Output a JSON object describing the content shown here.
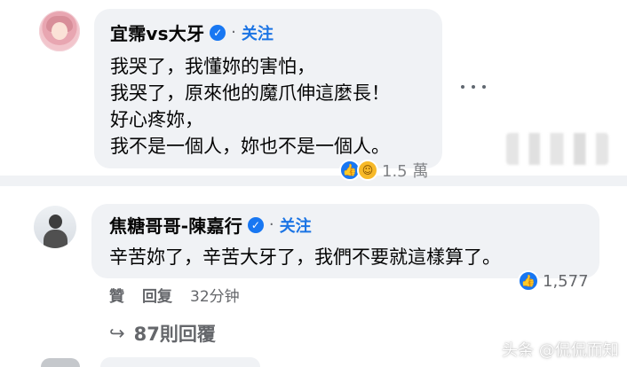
{
  "comments": [
    {
      "author": "宜霈vs大牙",
      "follow": "关注",
      "lines": [
        "我哭了，我懂妳的害怕，",
        "我哭了，原來他的魔爪伸這麼長！",
        "好心疼妳，",
        "我不是一個人，妳也不是一個人。"
      ],
      "reaction_count": "1.5 萬"
    },
    {
      "author": "焦糖哥哥-陳嘉行",
      "follow": "关注",
      "lines": [
        "辛苦妳了，辛苦大牙了，我們不要就這樣算了。"
      ],
      "actions": {
        "like": "贊",
        "reply": "回复",
        "time": "32分钟"
      },
      "reaction_count": "1,577",
      "replies": "87則回覆"
    }
  ],
  "watermark": "头条 @侃侃而知",
  "colors": {
    "accent": "#1b74e4",
    "bubble": "#f0f2f5",
    "text": "#050505",
    "secondary": "#65676b"
  },
  "icons": {
    "verified": "verified-check-icon",
    "more": "more-options-icon",
    "like": "like-icon",
    "care": "care-icon",
    "reply_arrow": "reply-arrow-icon"
  }
}
